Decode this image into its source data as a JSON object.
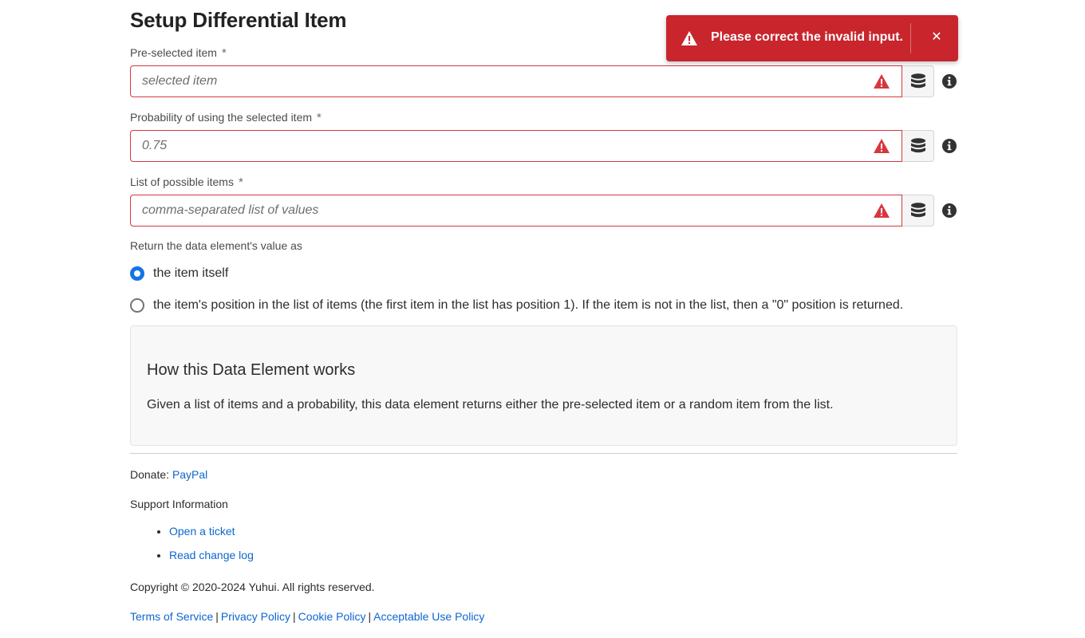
{
  "page": {
    "title": "Setup Differential Item"
  },
  "fields": [
    {
      "label": "Pre-selected item",
      "required_mark": "*",
      "value": "",
      "placeholder": "selected item"
    },
    {
      "label": "Probability of using the selected item",
      "required_mark": "*",
      "value": "",
      "placeholder": "0.75"
    },
    {
      "label": "List of possible items",
      "required_mark": "*",
      "value": "",
      "placeholder": "comma-separated list of values"
    }
  ],
  "return_as": {
    "label": "Return the data element's value as",
    "options": [
      {
        "label": "the item itself",
        "selected": true
      },
      {
        "label": "the item's position in the list of items (the first item in the list has position 1). If the item is not in the list, then a \"0\" position is returned.",
        "selected": false
      }
    ]
  },
  "help": {
    "title": "How this Data Element works",
    "text": "Given a list of items and a probability, this data element returns either the pre-selected item or a random item from the list."
  },
  "footer": {
    "donate_label": "Donate:",
    "donate_link": "PayPal",
    "support_title": "Support Information",
    "support_links": [
      "Open a ticket",
      "Read change log"
    ],
    "copyright": "Copyright © 2020-2024 Yuhui. All rights reserved.",
    "policy_links": [
      "Terms of Service",
      "Privacy Policy",
      "Cookie Policy",
      "Acceptable Use Policy"
    ],
    "separator": "|"
  },
  "toast": {
    "message": "Please correct the invalid input.",
    "close_symbol": "✕"
  },
  "icons": {
    "field_warning": "alert-triangle-icon",
    "data_element": "database-icon",
    "info": "info-icon",
    "toast_warning": "alert-triangle-icon",
    "close": "close-icon"
  },
  "colors": {
    "error": "#d7373f",
    "toast_bg": "#c9252d",
    "link": "#0d66d0",
    "radio_selected": "#1473e6"
  }
}
